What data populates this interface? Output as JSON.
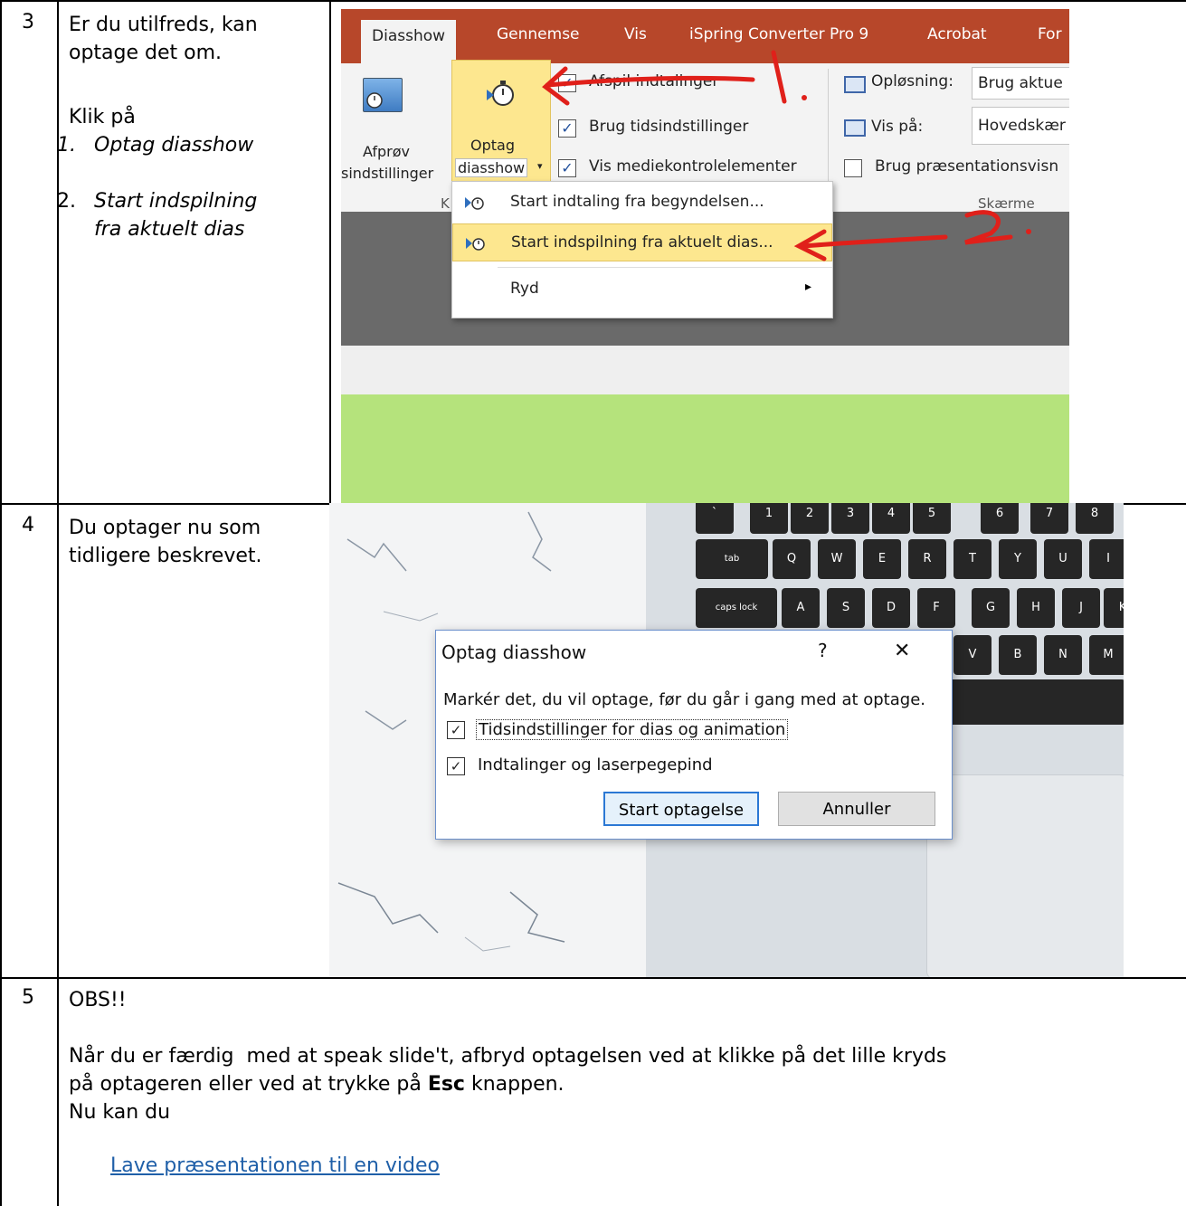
{
  "rows": [
    {
      "number": "3",
      "text_lines": [
        "Er du utilfreds, kan",
        "optage det om.",
        "Klik på"
      ],
      "steps": [
        {
          "marker": "1.",
          "text": "Optag diasshow"
        },
        {
          "marker": "2.",
          "text": "Start indspilning",
          "text2": "fra aktuelt dias"
        }
      ]
    },
    {
      "number": "4",
      "text_lines": [
        "Du optager nu som",
        "tidligere beskrevet."
      ]
    },
    {
      "number": "5",
      "heading": "OBS!!",
      "paragraph_line1": "Når du er færdig  med at speak slide't, afbryd optagelsen ved at klikke på det lille kryds",
      "paragraph_line2_a": "på optageren eller ved at trykke på ",
      "paragraph_line2_bold": "Esc",
      "paragraph_line2_b": " knappen.",
      "paragraph_line3": "Nu kan du",
      "link_text": "Lave præsentationen til en video"
    }
  ],
  "ribbon_screenshot": {
    "tabs": [
      "Diasshow",
      "Gennemse",
      "Vis",
      "iSpring Converter Pro 9",
      "Acrobat",
      "For"
    ],
    "buttons": {
      "test_label_1": "Afprøv",
      "test_label_2": "sindstillinger",
      "record_label_1": "Optag",
      "record_label_2": "diasshow",
      "record_caret": "▾",
      "group_letter": "K"
    },
    "checkboxes": [
      {
        "label": "Afspil indtalinger",
        "checked": true
      },
      {
        "label": "Brug tidsindstillinger",
        "checked": true
      },
      {
        "label": "Vis mediekontrolelementer",
        "checked": true
      }
    ],
    "monitors": {
      "resolution_label": "Opløsning:",
      "resolution_value": "Brug aktue",
      "show_on_label": "Vis på:",
      "show_on_value": "Hovedskær",
      "presenter_label": "Brug præsentationsvisn",
      "presenter_checked": false,
      "group_label": "Skærme"
    },
    "menu_items": [
      {
        "label": "Start indtaling fra begyndelsen...",
        "highlighted": false
      },
      {
        "label": "Start indspilning fra aktuelt dias...",
        "highlighted": true
      },
      {
        "label": "Ryd",
        "highlighted": false,
        "submenu_arrow": "▸"
      }
    ],
    "annotations": [
      "1.",
      "2."
    ],
    "accent_color": "#b7472a"
  },
  "dialog_screenshot": {
    "title": "Optag diasshow",
    "help": "?",
    "close": "✕",
    "instruction": "Markér det, du vil optage, før du går i gang med at optage.",
    "options": [
      {
        "label": "Tidsindstillinger for dias og animation",
        "checked": true
      },
      {
        "label": "Indtalinger og laserpegepind",
        "checked": true
      }
    ],
    "start_button": "Start optagelse",
    "cancel_button": "Annuller",
    "keyboard_keys_row1": [
      "`",
      "1",
      "2",
      "3",
      "4",
      "5",
      "6",
      "7",
      "8"
    ],
    "keyboard_keys_row2": [
      "tab",
      "Q",
      "W",
      "E",
      "R",
      "T",
      "Y",
      "U",
      "I"
    ],
    "keyboard_keys_row3": [
      "caps lock",
      "A",
      "S",
      "D",
      "F",
      "G",
      "H",
      "J",
      "K"
    ],
    "keyboard_keys_row4": [
      "V",
      "B",
      "N",
      "M"
    ]
  }
}
